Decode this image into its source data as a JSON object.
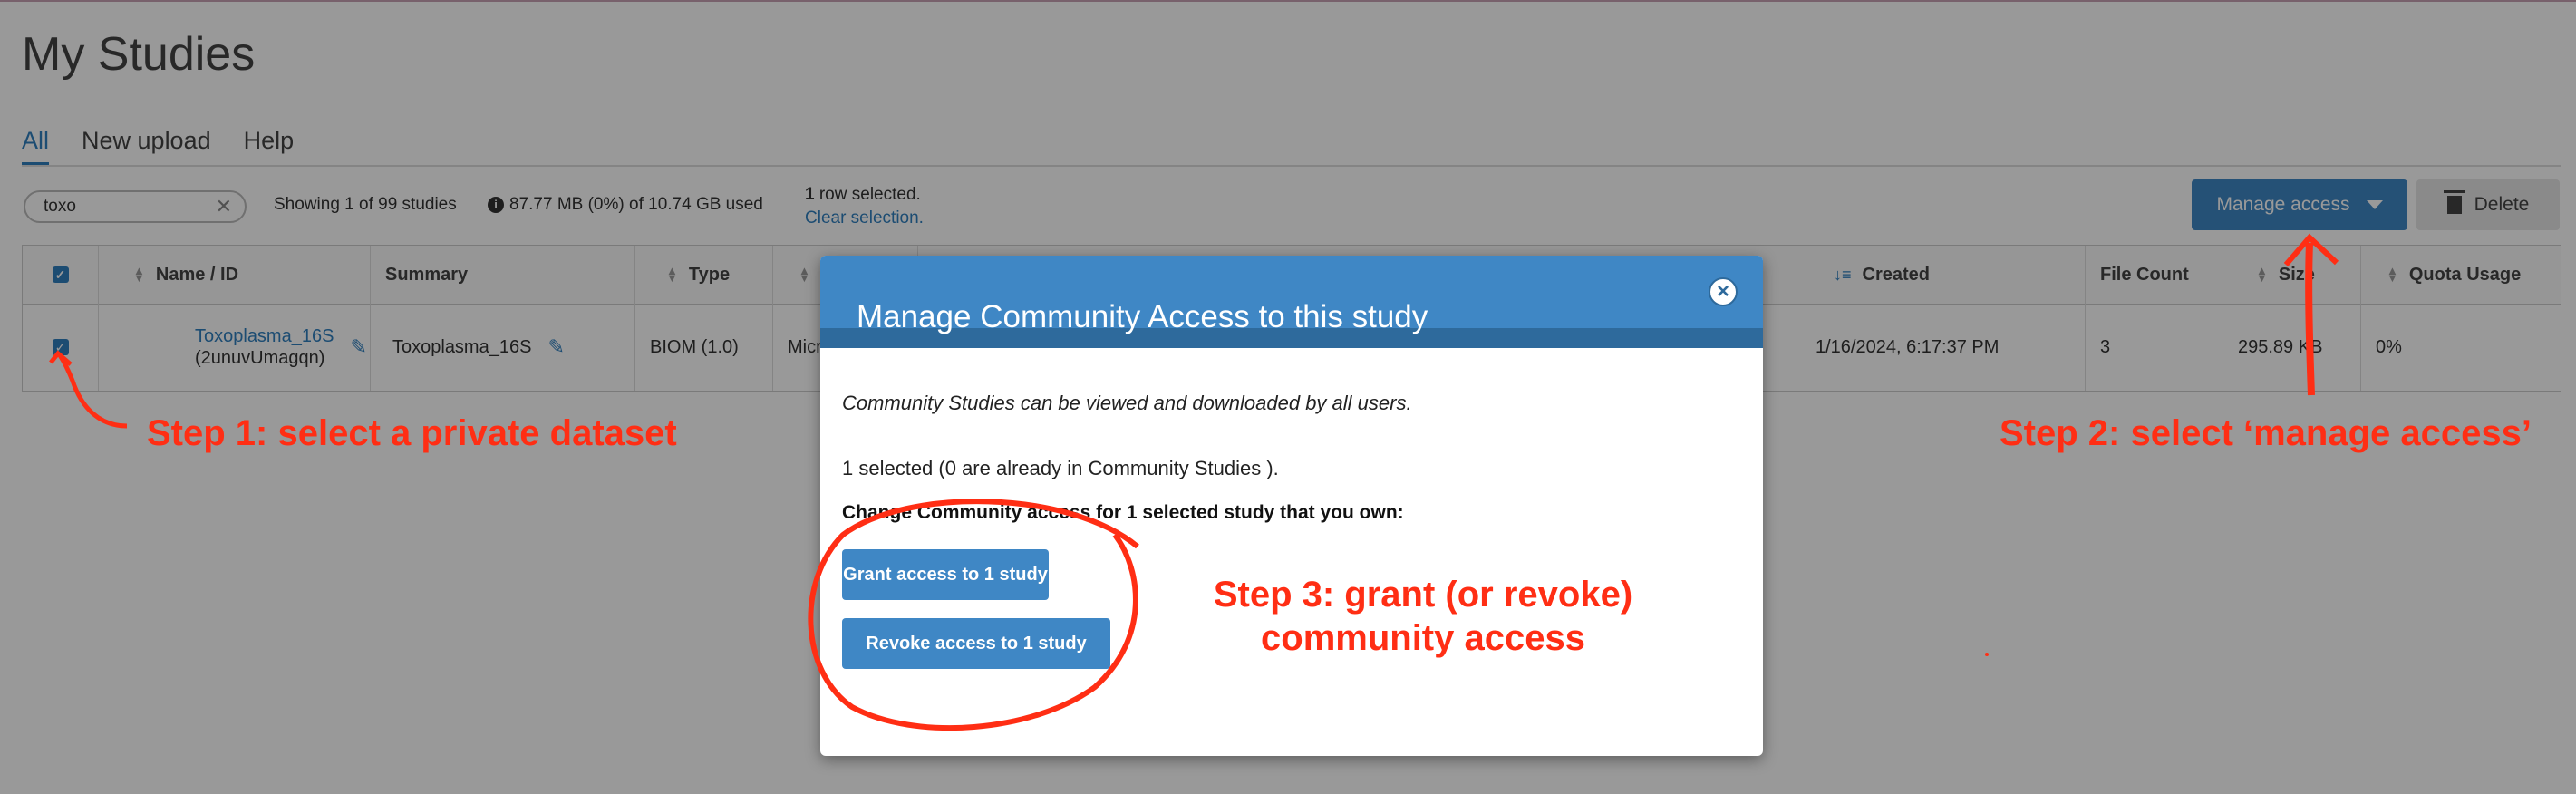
{
  "page": {
    "title": "My Studies"
  },
  "tabs": [
    {
      "label": "All",
      "active": true
    },
    {
      "label": "New upload",
      "active": false
    },
    {
      "label": "Help",
      "active": false
    }
  ],
  "toolbar": {
    "search_value": "toxo",
    "search_clear_icon": "x-icon",
    "showing": "Showing 1 of 99 studies",
    "storage": "87.77 MB (0%) of 10.74 GB used",
    "row_count": "1",
    "row_selected_text": " row selected.",
    "clear_selection": "Clear selection.",
    "manage_access": "Manage access",
    "delete": "Delete"
  },
  "table": {
    "headers": {
      "name": "Name / ID",
      "summary": "Summary",
      "type": "Type",
      "created": "Created",
      "file_count": "File Count",
      "size": "Size",
      "quota": "Quota Usage"
    },
    "row": {
      "name": "Toxoplasma_16S",
      "id": "(2unuvUmagqn)",
      "summary": "Toxoplasma_16S",
      "type": "BIOM (1.0)",
      "type_partial": "Micr",
      "created": "1/16/2024, 6:17:37 PM",
      "file_count": "3",
      "size": "295.89 KB",
      "quota": "0%"
    }
  },
  "modal": {
    "title": "Manage Community Access to this study",
    "description": "Community Studies can be viewed and downloaded by all users.",
    "selected_info": "1 selected (0 are already in Community Studies ).",
    "change_text": "Change Community access for 1 selected study that you own:",
    "grant_button": "Grant access to 1 study",
    "revoke_button": "Revoke access to 1 study"
  },
  "annotations": {
    "step1": "Step 1: select a private dataset",
    "step2": "Step 2: select ‘manage access’",
    "step3_line1": "Step 3: grant (or revoke)",
    "step3_line2": "community access",
    "color": "#ff2e14"
  },
  "colors": {
    "accent": "#3f87c5",
    "header_dark": "#2e6a9c"
  }
}
